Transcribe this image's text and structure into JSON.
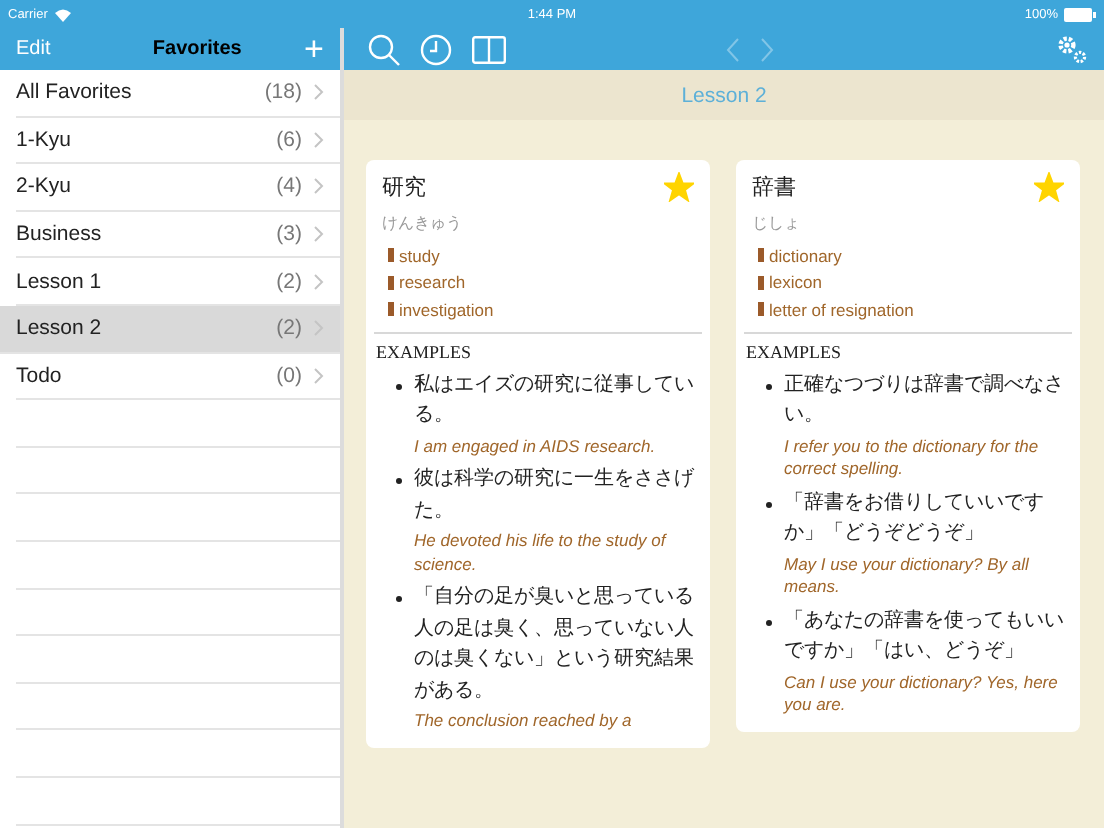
{
  "status_bar": {
    "carrier": "Carrier",
    "time": "1:44 PM",
    "battery": "100%"
  },
  "sidebar": {
    "edit": "Edit",
    "title": "Favorites",
    "add": "+",
    "items": [
      {
        "label": "All Favorites",
        "count": "(18)",
        "selected": false
      },
      {
        "label": "1-Kyu",
        "count": "(6)",
        "selected": false
      },
      {
        "label": "2-Kyu",
        "count": "(4)",
        "selected": false
      },
      {
        "label": "Business",
        "count": "(3)",
        "selected": false
      },
      {
        "label": "Lesson 1",
        "count": "(2)",
        "selected": false
      },
      {
        "label": "Lesson 2",
        "count": "(2)",
        "selected": true
      },
      {
        "label": "Todo",
        "count": "(0)",
        "selected": false
      }
    ]
  },
  "toolbar": {
    "history_arrows_disabled": true
  },
  "lesson_title": "Lesson 2",
  "cards": [
    {
      "word": "研究",
      "reading": "けんきゅう",
      "favorite": true,
      "meanings": [
        "study",
        "research",
        "investigation"
      ],
      "examples_heading": "EXAMPLES",
      "examples": [
        {
          "ja": "私はエイズの研究に従事している。",
          "en": "I am engaged in AIDS research."
        },
        {
          "ja": "彼は科学の研究に一生をささげた。",
          "en": "He devoted his life to the study of science."
        },
        {
          "ja": "「自分の足が臭いと思っている人の足は臭く、思っていない人のは臭くない」という研究結果がある。",
          "en": "The conclusion reached by a"
        }
      ]
    },
    {
      "word": "辞書",
      "reading": "じしょ",
      "favorite": true,
      "meanings": [
        "dictionary",
        "lexicon",
        "letter of resignation"
      ],
      "examples_heading": "EXAMPLES",
      "examples": [
        {
          "ja": "正確なつづりは辞書で調べなさい。",
          "en": "I refer you to the dictionary for the correct spelling."
        },
        {
          "ja": "「辞書をお借りしていいですか」「どうぞどうぞ」",
          "en": "May I use your dictionary? By all means."
        },
        {
          "ja": "「あなたの辞書を使ってもいいですか」「はい、どうぞ」",
          "en": "Can I use your dictionary? Yes, here you are."
        }
      ]
    }
  ]
}
